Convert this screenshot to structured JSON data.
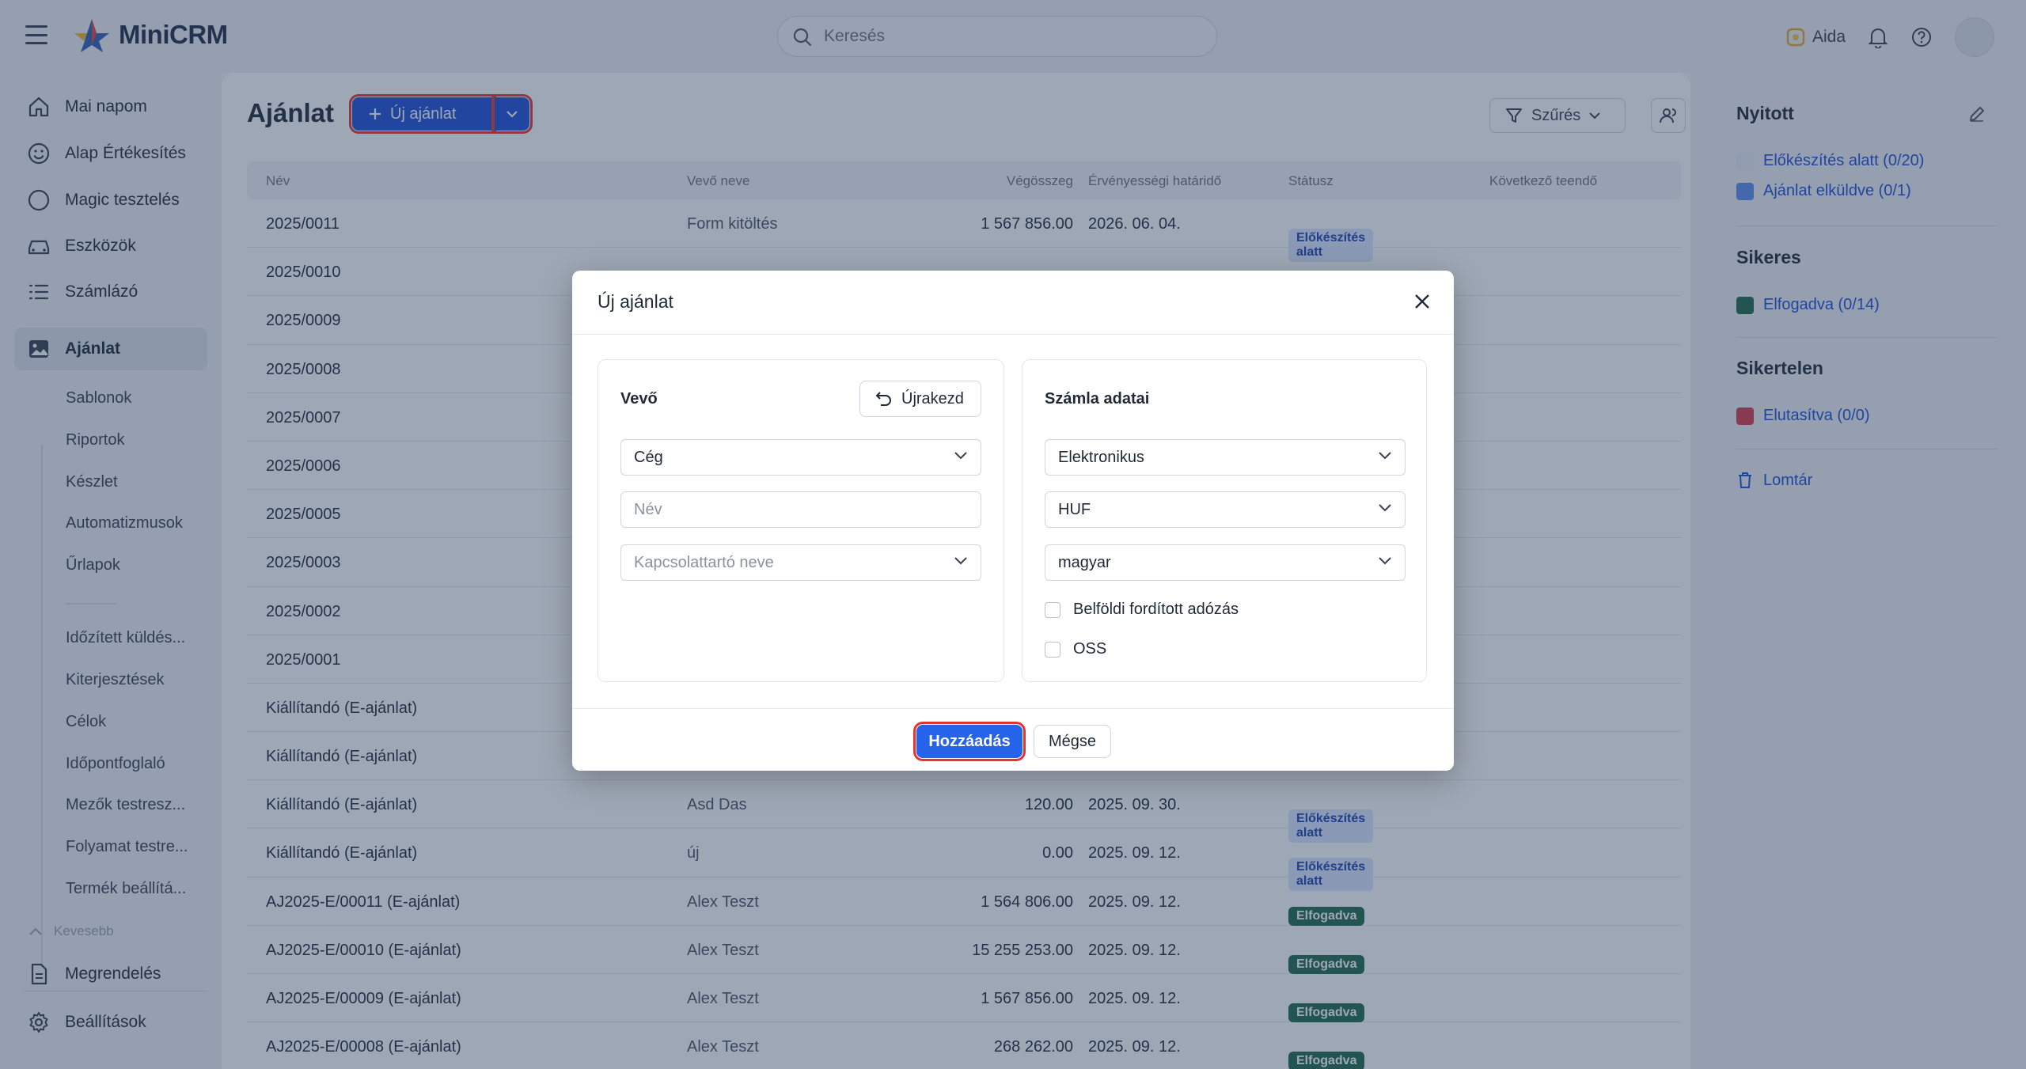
{
  "header": {
    "brand": "MiniCRM",
    "search_placeholder": "Keresés",
    "assistant_label": "Aida"
  },
  "sidebar": {
    "main_items": [
      {
        "label": "Mai napom",
        "icon": "home-icon"
      },
      {
        "label": "Alap Értékesítés",
        "icon": "smiley-icon"
      },
      {
        "label": "Magic tesztelés",
        "icon": "circle-icon"
      },
      {
        "label": "Eszközök",
        "icon": "car-icon"
      },
      {
        "label": "Számlázó",
        "icon": "list-icon"
      },
      {
        "label": "Ajánlat",
        "icon": "image-icon"
      }
    ],
    "sub_items": [
      "Sablonok",
      "Riportok",
      "Készlet",
      "Automatizmusok",
      "Űrlapok",
      "Időzített küldés...",
      "Kiterjesztések",
      "Célok",
      "Időpontfoglaló",
      "Mezők testresz...",
      "Folyamat testre...",
      "Termék beállítá..."
    ],
    "less_label": "Kevesebb",
    "bottom_items": [
      {
        "label": "Megrendelés",
        "icon": "document-icon"
      },
      {
        "label": "Beállítások",
        "icon": "gear-icon"
      }
    ]
  },
  "main": {
    "title": "Ajánlat",
    "new_button": "Új ajánlat",
    "filter_button": "Szűrés",
    "columns": [
      "Név",
      "Vevő neve",
      "Végösszeg",
      "Érvényességi határidő",
      "Státusz",
      "Következő teendő"
    ],
    "rows": [
      {
        "name": "2025/0011",
        "customer": "Form kitöltés",
        "total": "1 567 856.00",
        "date": "2026. 06. 04.",
        "status": "Előkészítés alatt",
        "status_type": "prep"
      },
      {
        "name": "2025/0010",
        "customer": "",
        "total": "",
        "date": "",
        "status": "",
        "status_type": ""
      },
      {
        "name": "2025/0009",
        "customer": "",
        "total": "",
        "date": "",
        "status": "",
        "status_type": ""
      },
      {
        "name": "2025/0008",
        "customer": "",
        "total": "",
        "date": "",
        "status": "",
        "status_type": ""
      },
      {
        "name": "2025/0007",
        "customer": "",
        "total": "",
        "date": "",
        "status": "",
        "status_type": ""
      },
      {
        "name": "2025/0006",
        "customer": "",
        "total": "",
        "date": "",
        "status": "",
        "status_type": ""
      },
      {
        "name": "2025/0005",
        "customer": "",
        "total": "",
        "date": "",
        "status": "",
        "status_type": ""
      },
      {
        "name": "2025/0003",
        "customer": "",
        "total": "",
        "date": "",
        "status": "",
        "status_type": ""
      },
      {
        "name": "2025/0002",
        "customer": "",
        "total": "",
        "date": "",
        "status": "",
        "status_type": ""
      },
      {
        "name": "2025/0001",
        "customer": "",
        "total": "",
        "date": "",
        "status": "",
        "status_type": ""
      },
      {
        "name": "Kiállítandó (E-ajánlat)",
        "customer": "",
        "total": "",
        "date": "",
        "status": "",
        "status_type": ""
      },
      {
        "name": "Kiállítandó (E-ajánlat)",
        "customer": "",
        "total": "",
        "date": "",
        "status": "",
        "status_type": ""
      },
      {
        "name": "Kiállítandó (E-ajánlat)",
        "customer": "Asd Das",
        "total": "120.00",
        "date": "2025. 09. 30.",
        "status": "Előkészítés alatt",
        "status_type": "prep"
      },
      {
        "name": "Kiállítandó (E-ajánlat)",
        "customer": "új",
        "total": "0.00",
        "date": "2025. 09. 12.",
        "status": "Előkészítés alatt",
        "status_type": "prep"
      },
      {
        "name": "AJ2025-E/00011 (E-ajánlat)",
        "customer": "Alex Teszt",
        "total": "1 564 806.00",
        "date": "2025. 09. 12.",
        "status": "Elfogadva",
        "status_type": "acc"
      },
      {
        "name": "AJ2025-E/00010 (E-ajánlat)",
        "customer": "Alex Teszt",
        "total": "15 255 253.00",
        "date": "2025. 09. 12.",
        "status": "Elfogadva",
        "status_type": "acc"
      },
      {
        "name": "AJ2025-E/00009 (E-ajánlat)",
        "customer": "Alex Teszt",
        "total": "1 567 856.00",
        "date": "2025. 09. 12.",
        "status": "Elfogadva",
        "status_type": "acc"
      },
      {
        "name": "AJ2025-E/00008 (E-ajánlat)",
        "customer": "Alex Teszt",
        "total": "268 262.00",
        "date": "2025. 09. 12.",
        "status": "Elfogadva",
        "status_type": "acc"
      }
    ]
  },
  "right_panel": {
    "sections": [
      {
        "title": "Nyitott",
        "items": [
          {
            "label": "Előkészítés alatt (0/20)",
            "color": "#e6edf7"
          },
          {
            "label": "Ajánlat elküldve (0/1)",
            "color": "#5b8def"
          }
        ]
      },
      {
        "title": "Sikeres",
        "items": [
          {
            "label": "Elfogadva (0/14)",
            "color": "#1e6b4a"
          }
        ]
      },
      {
        "title": "Sikertelen",
        "items": [
          {
            "label": "Elutasítva (0/0)",
            "color": "#d83a4a"
          }
        ]
      }
    ],
    "trash_label": "Lomtár"
  },
  "modal": {
    "title": "Új ajánlat",
    "customer_section": {
      "title": "Vevő",
      "restart_button": "Újrakezd",
      "type_value": "Cég",
      "name_placeholder": "Név",
      "contact_placeholder": "Kapcsolattartó neve"
    },
    "invoice_section": {
      "title": "Számla adatai",
      "format_value": "Elektronikus",
      "currency_value": "HUF",
      "language_value": "magyar",
      "reverse_tax_label": "Belföldi fordított adózás",
      "oss_label": "OSS"
    },
    "add_button": "Hozzáadás",
    "cancel_button": "Mégse"
  },
  "colors": {
    "primary": "#2563eb",
    "highlight_outline": "#e3342f",
    "accepted": "#1e6b4a"
  }
}
